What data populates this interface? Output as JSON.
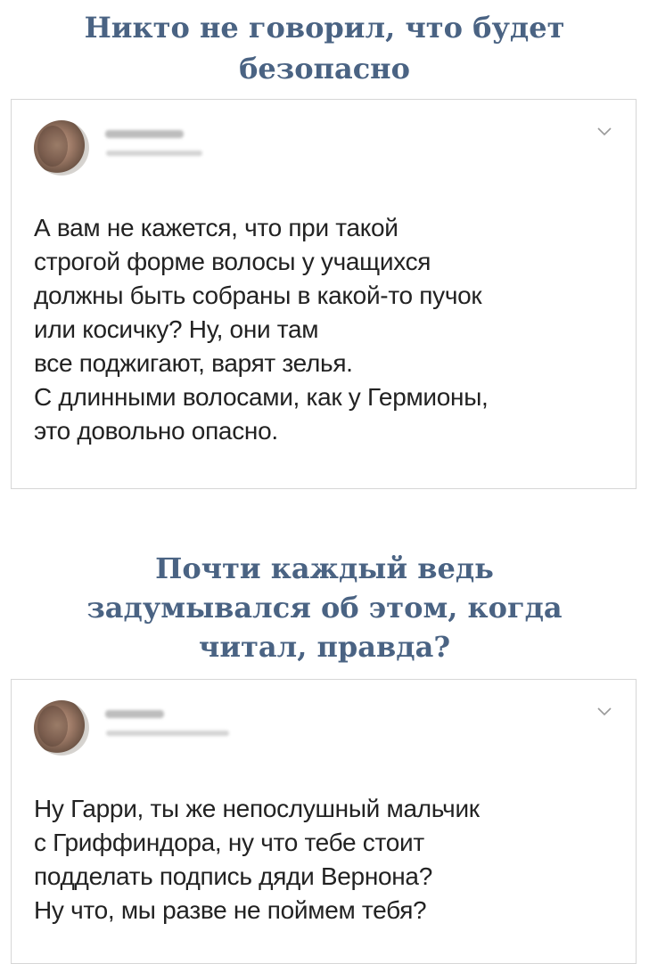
{
  "post_1": {
    "heading": "Никто не говорил, что будет\nбезопасно",
    "tweet_text": "А вам не кажется, что при такой\nстрогой форме волосы у учащихся\nдолжны быть собраны в какой-то пучок\nили косичку? Ну, они там\nвсе поджигают, варят зелья.\nС длинными волосами, как у Гермионы,\nэто довольно опасно.",
    "author_name_blurred": true,
    "author_handle_blurred": true,
    "menu_icon": "chevron-down-icon"
  },
  "post_2": {
    "heading": "Почти каждый ведь\nзадумывался об этом, когда\nчитал, правда?",
    "tweet_text": "Ну Гарри, ты же непослушный мальчик\nс Гриффиндора, ну что тебе стоит\nподделать подпись дяди Вернона?\nНу что, мы разве не поймем тебя?",
    "author_name_blurred": true,
    "author_handle_blurred": true,
    "menu_icon": "chevron-down-icon"
  },
  "colors": {
    "heading": "#4a6383",
    "tweet_text": "#222222",
    "card_border": "#d6d6d6",
    "chevron": "#9a9a9a"
  }
}
